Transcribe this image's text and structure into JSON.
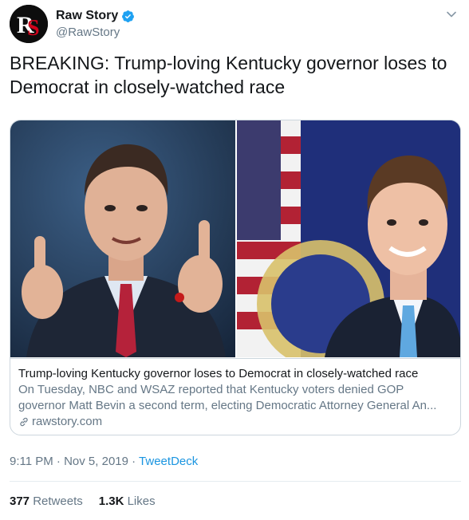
{
  "author": {
    "name": "Raw Story",
    "handle": "@RawStory",
    "avatar_text": "RS",
    "avatar_color": "#d0021b"
  },
  "tweet": {
    "line1": "BREAKING: Trump-loving Kentucky governor loses to",
    "line2": "Democrat in closely-watched race"
  },
  "card": {
    "title": "Trump-loving Kentucky governor loses to Democrat in closely-watched race",
    "desc_line1": "On Tuesday, NBC and WSAZ reported that Kentucky voters denied GOP",
    "desc_line2": "governor Matt Bevin a second term, electing Democratic Attorney General An...",
    "domain": "rawstory.com"
  },
  "meta": {
    "time": "9:11 PM",
    "dot1": " · ",
    "date": "Nov 5, 2019",
    "dot2": " · ",
    "source": "TweetDeck"
  },
  "stats": {
    "retweets_count": "377",
    "retweets_label": "Retweets",
    "likes_count": "1.3K",
    "likes_label": "Likes"
  },
  "colors": {
    "link_blue": "#1b95e0",
    "verified_blue": "#1da1f2",
    "muted": "#657786"
  }
}
